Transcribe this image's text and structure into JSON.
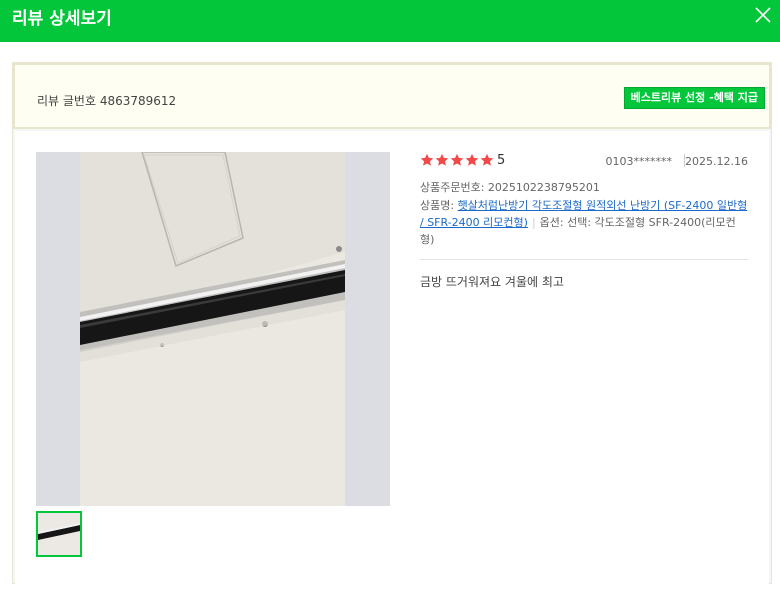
{
  "header": {
    "title": "리뷰 상세보기"
  },
  "info": {
    "review_number": "리뷰 글번호 4863789612",
    "best_badge": "베스트리뷰 선정 -혜택 지급"
  },
  "review": {
    "rating": 5,
    "rating_text": "5",
    "author": "0103*******",
    "date": "2025.12.16",
    "order_number": "상품주문번호: 2025102238795201",
    "product_label": "상품명: ",
    "product_name": "햇살처럼난방기 각도조절형 원적외선 난방기 (SF-2400 일반형 / SFR-2400 리모컨형)",
    "option": "옵션: 선택: 각도조절형 SFR-2400(리모컨형)",
    "text": "금방 뜨거워져요 겨울에 최고"
  },
  "colors": {
    "brand": "#03c63a",
    "star": "#f04a4a",
    "link": "#1b6ac9"
  },
  "icons": {
    "close": "close-icon",
    "star": "star-icon"
  }
}
